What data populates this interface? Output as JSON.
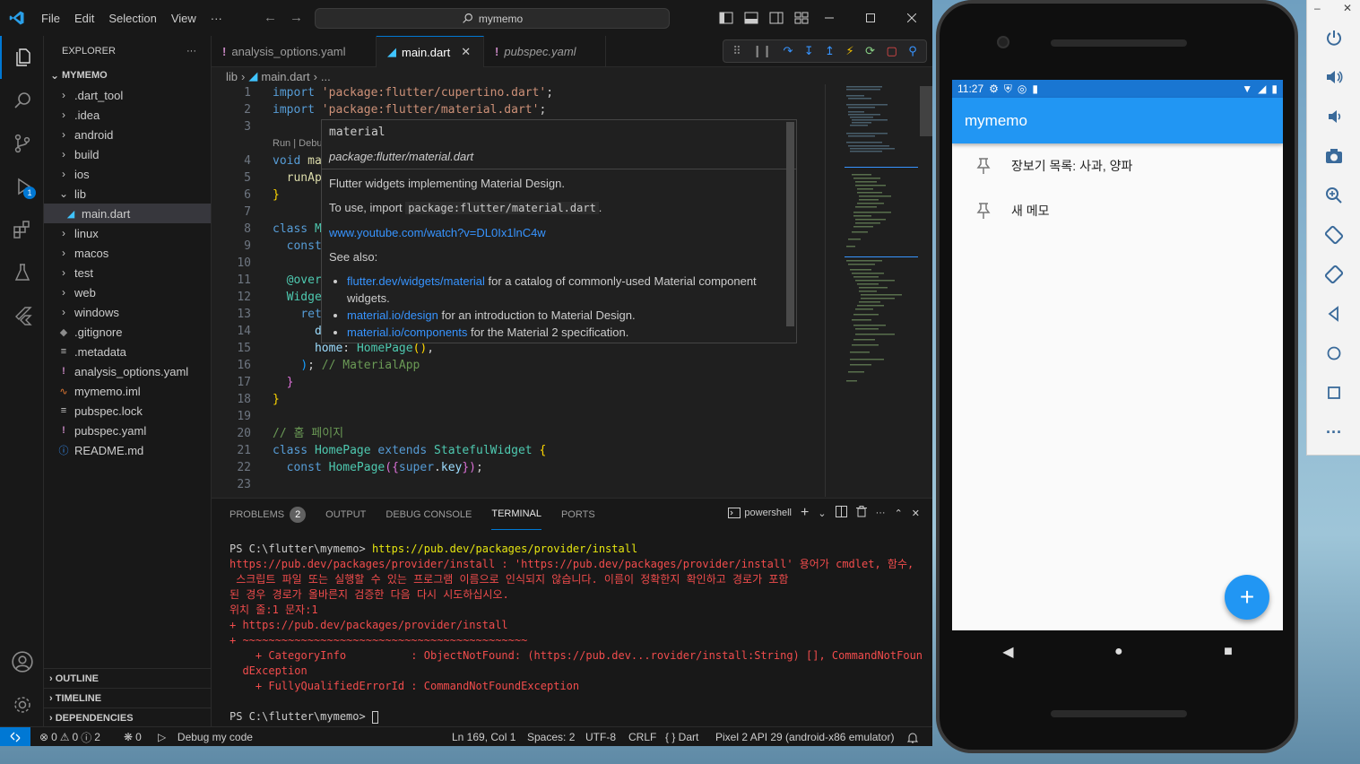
{
  "vscode": {
    "menu": [
      "File",
      "Edit",
      "Selection",
      "View"
    ],
    "more": "···",
    "search": "mymemo",
    "sidebar": {
      "title": "EXPLORER",
      "root": "MYMEMO",
      "items": [
        {
          "label": ".dart_tool",
          "type": "folder"
        },
        {
          "label": ".idea",
          "type": "folder"
        },
        {
          "label": "android",
          "type": "folder"
        },
        {
          "label": "build",
          "type": "folder"
        },
        {
          "label": "ios",
          "type": "folder"
        },
        {
          "label": "lib",
          "type": "folder-open"
        },
        {
          "label": "main.dart",
          "type": "dart"
        },
        {
          "label": "linux",
          "type": "folder"
        },
        {
          "label": "macos",
          "type": "folder"
        },
        {
          "label": "test",
          "type": "folder"
        },
        {
          "label": "web",
          "type": "folder"
        },
        {
          "label": "windows",
          "type": "folder"
        },
        {
          "label": ".gitignore",
          "type": "git"
        },
        {
          "label": ".metadata",
          "type": "lines"
        },
        {
          "label": "analysis_options.yaml",
          "type": "yaml"
        },
        {
          "label": "mymemo.iml",
          "type": "rss"
        },
        {
          "label": "pubspec.lock",
          "type": "lines"
        },
        {
          "label": "pubspec.yaml",
          "type": "yaml"
        },
        {
          "label": "README.md",
          "type": "info"
        }
      ],
      "sections": [
        "OUTLINE",
        "TIMELINE",
        "DEPENDENCIES"
      ]
    },
    "tabs": [
      {
        "label": "analysis_options.yaml"
      },
      {
        "label": "main.dart"
      },
      {
        "label": "pubspec.yaml"
      }
    ],
    "breadcrumb": [
      "lib",
      "main.dart",
      "..."
    ],
    "activity_badge": "1",
    "hover": {
      "name": "material",
      "path": "package:flutter/material.dart",
      "desc": "Flutter widgets implementing Material Design.",
      "use_pre": "To use, import",
      "use_code": "package:flutter/material.dart",
      "use_post": ".",
      "link": "www.youtube.com/watch?v=DL0Ix1lnC4w",
      "see_also": "See also:",
      "bullets": [
        {
          "link": "flutter.dev/widgets/material",
          "text": " for a catalog of commonly-used Material component widgets."
        },
        {
          "link": "material.io/design",
          "text": " for an introduction to Material Design."
        },
        {
          "link": "material.io/components",
          "text": " for the Material 2 specification."
        }
      ]
    },
    "panel": {
      "tabs": [
        "PROBLEMS",
        "OUTPUT",
        "DEBUG CONSOLE",
        "TERMINAL",
        "PORTS"
      ],
      "problems_count": "2",
      "shell": "powershell",
      "terminal": [
        {
          "cls": "",
          "prompt": "PS C:\\flutter\\mymemo> ",
          "cmd": "https://pub.dev/packages/provider/install"
        },
        {
          "cls": "err",
          "text": "https://pub.dev/packages/provider/install : 'https://pub.dev/packages/provider/install' 용어가 cmdlet, 함수,"
        },
        {
          "cls": "err",
          "text": " 스크립트 파일 또는 실행할 수 있는 프로그램 이름으로 인식되지 않습니다. 이름이 정확한지 확인하고 경로가 포함"
        },
        {
          "cls": "err",
          "text": "된 경우 경로가 올바른지 검증한 다음 다시 시도하십시오."
        },
        {
          "cls": "err",
          "text": "위치 줄:1 문자:1"
        },
        {
          "cls": "err",
          "text": "+ https://pub.dev/packages/provider/install"
        },
        {
          "cls": "err",
          "text": "+ ~~~~~~~~~~~~~~~~~~~~~~~~~~~~~~~~~~~~~~~~~~~~"
        },
        {
          "cls": "err",
          "text": "    + CategoryInfo          : ObjectNotFound: (https://pub.dev...rovider/install:String) [], CommandNotFoun"
        },
        {
          "cls": "err",
          "text": "  dException"
        },
        {
          "cls": "err",
          "text": "    + FullyQualifiedErrorId : CommandNotFoundException"
        },
        {
          "cls": "",
          "text": " "
        },
        {
          "cls": "",
          "prompt": "PS C:\\flutter\\mymemo> ",
          "cmd": ""
        }
      ]
    },
    "status": {
      "errors": "0",
      "warnings": "0",
      "infos": "2",
      "ports": "0",
      "debug": "Debug my code",
      "position": "Ln 169, Col 1",
      "spaces": "Spaces: 2",
      "encoding": "UTF-8",
      "eol": "CRLF",
      "language": "{ } Dart",
      "device": "Pixel 2 API 29 (android-x86 emulator)"
    }
  },
  "phone": {
    "time": "11:27",
    "app_title": "mymemo",
    "memos": [
      "장보기 목록: 사과, 양파",
      "새 메모"
    ],
    "fab": "+"
  },
  "colors": {
    "accent": "#0078d4",
    "flutter_blue": "#2196f3",
    "error_red": "#f14c4c"
  }
}
